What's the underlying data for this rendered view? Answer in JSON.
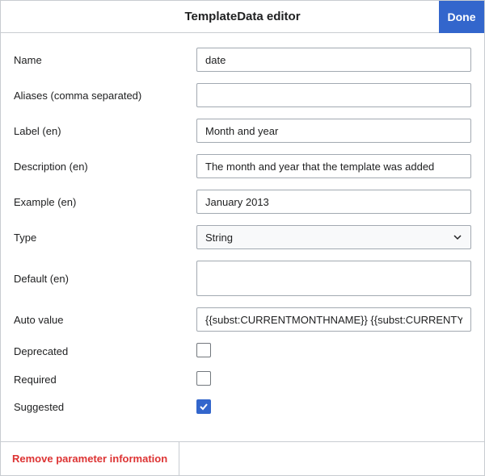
{
  "header": {
    "title": "TemplateData editor",
    "done_label": "Done"
  },
  "fields": {
    "name": {
      "label": "Name",
      "value": "date"
    },
    "aliases": {
      "label": "Aliases (comma separated)",
      "value": ""
    },
    "label": {
      "label": "Label (en)",
      "value": "Month and year"
    },
    "description": {
      "label": "Description (en)",
      "value": "The month and year that the template was added"
    },
    "example": {
      "label": "Example (en)",
      "value": "January 2013"
    },
    "type": {
      "label": "Type",
      "value": "String"
    },
    "default": {
      "label": "Default (en)",
      "value": ""
    },
    "autovalue": {
      "label": "Auto value",
      "value": "{{subst:CURRENTMONTHNAME}} {{subst:CURRENTYEAR}}"
    },
    "deprecated": {
      "label": "Deprecated",
      "checked": false
    },
    "required": {
      "label": "Required",
      "checked": false
    },
    "suggested": {
      "label": "Suggested",
      "checked": true
    }
  },
  "footer": {
    "remove_label": "Remove parameter information"
  }
}
